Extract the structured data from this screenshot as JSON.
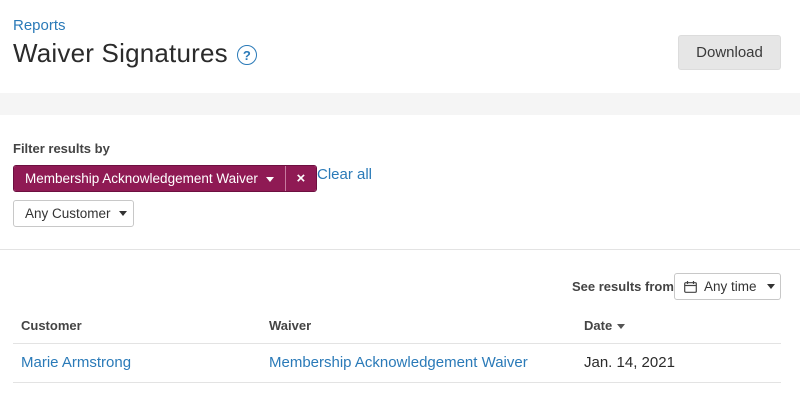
{
  "header": {
    "breadcrumb": "Reports",
    "title": "Waiver Signatures",
    "help_icon_glyph": "?",
    "download_label": "Download"
  },
  "filters": {
    "label": "Filter results by",
    "active_filter": "Membership Acknowledgement Waiver",
    "remove_glyph": "×",
    "clear_all": "Clear all",
    "customer_select": "Any Customer"
  },
  "results": {
    "see_results_label": "See results from",
    "time_select": "Any time"
  },
  "table": {
    "headers": {
      "customer": "Customer",
      "waiver": "Waiver",
      "date": "Date"
    },
    "rows": [
      {
        "customer": "Marie Armstrong",
        "waiver": "Membership Acknowledgement Waiver",
        "date": "Jan. 14, 2021"
      }
    ]
  },
  "colors": {
    "accent_link": "#2a7ab8",
    "filter_chip": "#8f1a54"
  },
  "icons": [
    "help-icon",
    "caret-down-icon",
    "close-icon",
    "calendar-icon",
    "sort-desc-icon"
  ]
}
